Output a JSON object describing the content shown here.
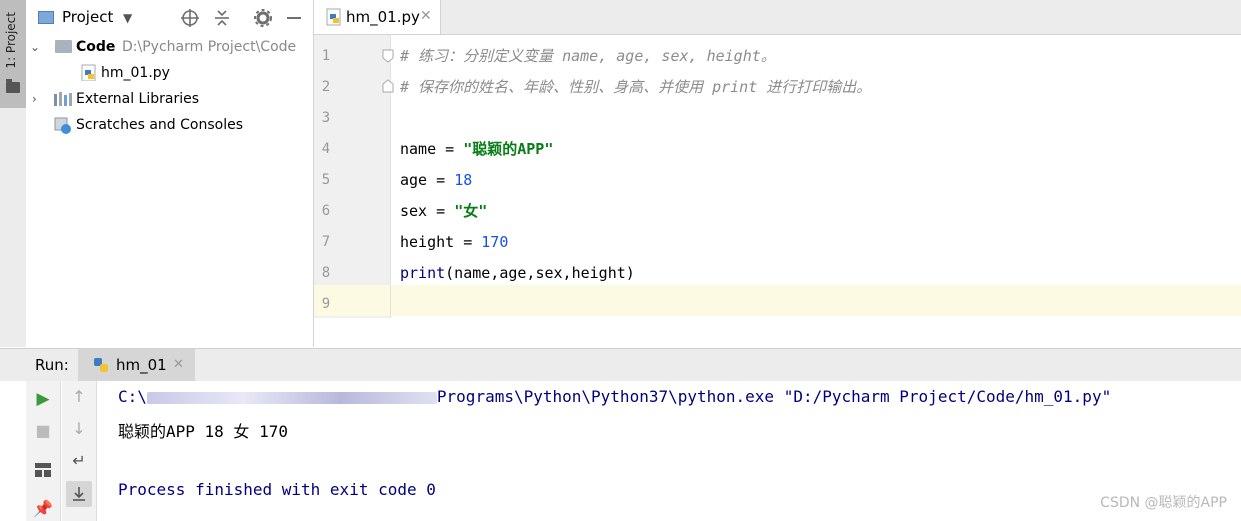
{
  "sidebar_strip": {
    "label": "1: Project"
  },
  "project_panel": {
    "title": "Project",
    "tree": {
      "root": {
        "name": "Code",
        "path": "D:\\Pycharm Project\\Code"
      },
      "file": "hm_01.py",
      "external": "External Libraries",
      "scratches": "Scratches and Consoles"
    }
  },
  "editor": {
    "tab_label": "hm_01.py",
    "line_numbers": [
      "1",
      "2",
      "3",
      "4",
      "5",
      "6",
      "7",
      "8",
      "9"
    ],
    "lines": {
      "l1": "# 练习：分别定义变量 name, age, sex, height。",
      "l2": "# 保存你的姓名、年龄、性别、身高、并使用 print 进行打印输出。",
      "l4_a": "name = ",
      "l4_b": "\"聪颖的APP\"",
      "l5_a": "age = ",
      "l5_b": "18",
      "l6_a": "sex = ",
      "l6_b": "\"女\"",
      "l7_a": "height = ",
      "l7_b": "170",
      "l8_a": "print",
      "l8_b": "(name,age,sex,height)"
    }
  },
  "run_panel": {
    "label": "Run:",
    "tab": "hm_01",
    "output": {
      "cmd_prefix": "C:\\",
      "cmd_suffix": "Programs\\Python\\Python37\\python.exe \"D:/Pycharm Project/Code/hm_01.py\"",
      "result": "聪颖的APP 18 女 170",
      "exit": "Process finished with exit code 0"
    }
  },
  "watermark": "CSDN @聪颖的APP",
  "colors": {
    "comment": "#8c8c8c",
    "string": "#067d17",
    "number": "#1750eb",
    "output_blue": "#000080"
  }
}
